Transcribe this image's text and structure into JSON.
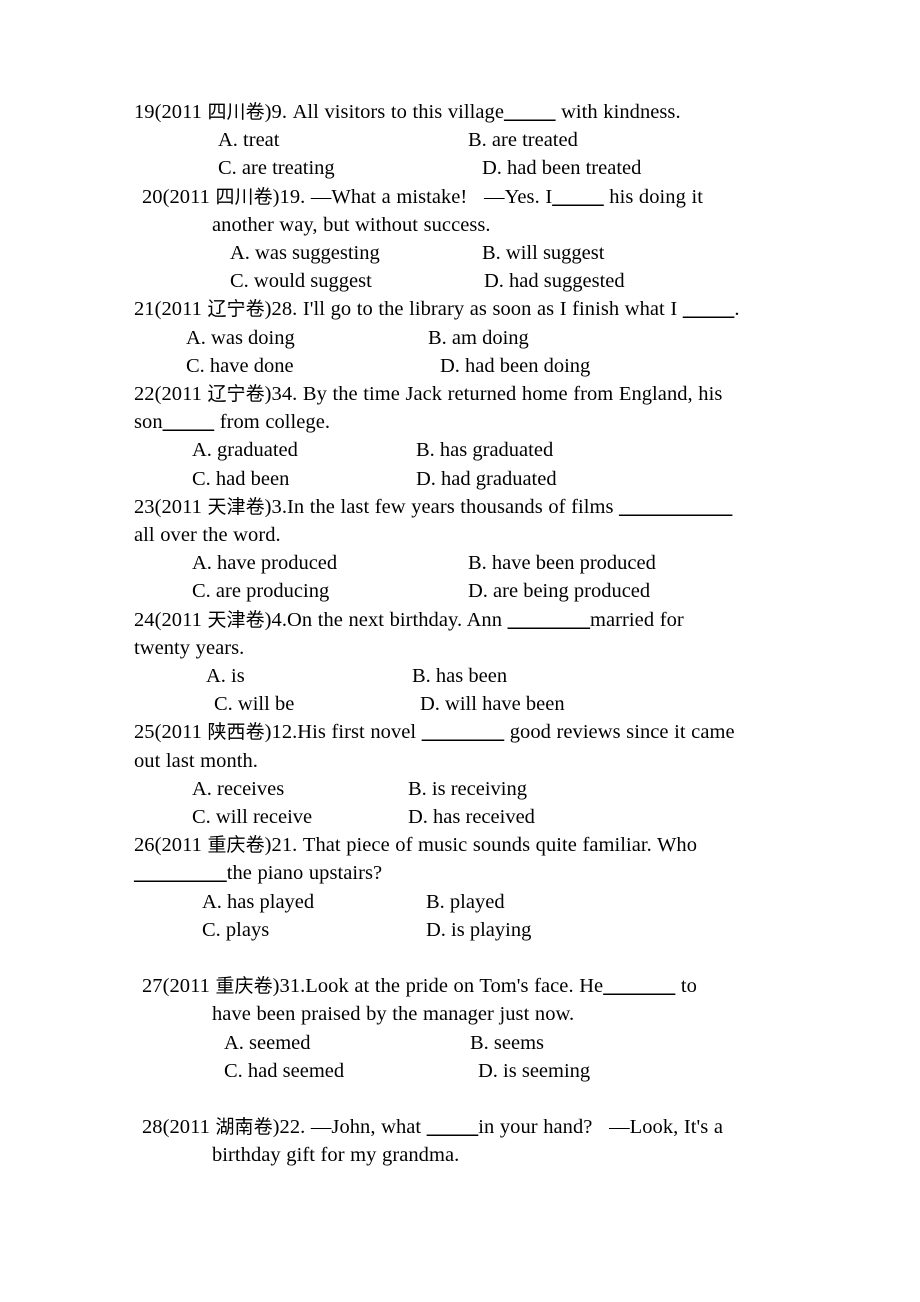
{
  "document": {
    "type": "grammar-exercise-worksheet",
    "language": "en-zh",
    "blank_marker": "_____"
  },
  "questions": [
    {
      "number": "19",
      "source": "(2011 四川卷)",
      "item_number": "9.",
      "stem_lines": [
        {
          "indent": "none",
          "segments": [
            {
              "type": "text",
              "text": "19(2011 "
            },
            {
              "type": "cjk",
              "text": "四川卷"
            },
            {
              "type": "text",
              "text": ")9. All visitors to this village"
            },
            {
              "type": "blank",
              "text": "_____"
            },
            {
              "type": "text",
              "text": " with kindness."
            }
          ]
        }
      ],
      "options": [
        {
          "label": "A.",
          "text": "treat",
          "full": "A. treat",
          "indent": 84,
          "column": "left"
        },
        {
          "label": "B.",
          "text": "are treated",
          "full": "B. are treated",
          "indent": 334,
          "column": "right"
        },
        {
          "label": "C.",
          "text": "are treating",
          "full": "C. are treating",
          "indent": 84,
          "column": "left"
        },
        {
          "label": "D.",
          "text": "had been treated",
          "full": "D. had been treated",
          "indent": 348,
          "column": "right"
        }
      ]
    },
    {
      "number": "20",
      "source": "(2011 四川卷)",
      "item_number": "19.",
      "stem_lines": [
        {
          "indent": "small",
          "segments": [
            {
              "type": "text",
              "text": "20(2011 "
            },
            {
              "type": "cjk",
              "text": "四川卷"
            },
            {
              "type": "text",
              "text": ")19. —What a mistake!   —Yes. I"
            },
            {
              "type": "blank",
              "text": "_____"
            },
            {
              "type": "text",
              "text": " his doing it"
            }
          ]
        },
        {
          "indent": "cont",
          "segments": [
            {
              "type": "text",
              "text": "another way, but without success."
            }
          ]
        }
      ],
      "options": [
        {
          "label": "A.",
          "text": "was suggesting",
          "full": "A. was suggesting",
          "indent": 96,
          "column": "left"
        },
        {
          "label": "B.",
          "text": "will suggest",
          "full": "B. will suggest",
          "indent": 348,
          "column": "right"
        },
        {
          "label": "C.",
          "text": "would suggest",
          "full": "C. would suggest",
          "indent": 96,
          "column": "left"
        },
        {
          "label": "D.",
          "text": "had suggested",
          "full": "D. had suggested",
          "indent": 350,
          "column": "right"
        }
      ]
    },
    {
      "number": "21",
      "source": "(2011 辽宁卷)",
      "item_number": "28.",
      "stem_lines": [
        {
          "indent": "none",
          "segments": [
            {
              "type": "text",
              "text": "21(2011 "
            },
            {
              "type": "cjk",
              "text": "辽宁卷"
            },
            {
              "type": "text",
              "text": ")28. I'll go to the library as soon as I finish what I "
            },
            {
              "type": "blank",
              "text": "_____"
            },
            {
              "type": "text",
              "text": "."
            }
          ]
        }
      ],
      "options": [
        {
          "label": "A.",
          "text": "was doing",
          "full": "A. was doing",
          "indent": 52,
          "column": "left"
        },
        {
          "label": "B.",
          "text": "am doing",
          "full": "B. am doing",
          "indent": 294,
          "column": "right"
        },
        {
          "label": "C.",
          "text": "have done",
          "full": "C. have done",
          "indent": 52,
          "column": "left"
        },
        {
          "label": "D.",
          "text": "had been doing",
          "full": "D. had been doing",
          "indent": 306,
          "column": "right"
        }
      ]
    },
    {
      "number": "22",
      "source": "(2011 辽宁卷)",
      "item_number": "34.",
      "stem_lines": [
        {
          "indent": "none",
          "segments": [
            {
              "type": "text",
              "text": "22(2011 "
            },
            {
              "type": "cjk",
              "text": "辽宁卷"
            },
            {
              "type": "text",
              "text": ")34. By the time Jack returned home from England, his"
            }
          ]
        },
        {
          "indent": "none",
          "segments": [
            {
              "type": "text",
              "text": "son"
            },
            {
              "type": "blank",
              "text": "_____"
            },
            {
              "type": "text",
              "text": " from college."
            }
          ]
        }
      ],
      "options": [
        {
          "label": "A.",
          "text": "graduated",
          "full": "A. graduated",
          "indent": 58,
          "column": "left"
        },
        {
          "label": "B.",
          "text": "has graduated",
          "full": "B. has graduated",
          "indent": 282,
          "column": "right"
        },
        {
          "label": "C.",
          "text": "had been",
          "full": "C. had been",
          "indent": 58,
          "column": "left"
        },
        {
          "label": "D.",
          "text": "had graduated",
          "full": "D. had graduated",
          "indent": 282,
          "column": "right"
        }
      ]
    },
    {
      "number": "23",
      "source": "(2011 天津卷)",
      "item_number": "3.",
      "stem_lines": [
        {
          "indent": "none",
          "segments": [
            {
              "type": "text",
              "text": "23(2011 "
            },
            {
              "type": "cjk",
              "text": "天津卷"
            },
            {
              "type": "text",
              "text": ")3.In the last few years thousands of films "
            },
            {
              "type": "blank",
              "text": "___________"
            }
          ]
        },
        {
          "indent": "none",
          "segments": [
            {
              "type": "text",
              "text": "all over the word."
            }
          ]
        }
      ],
      "options": [
        {
          "label": "A.",
          "text": "have produced",
          "full": "A. have produced",
          "indent": 58,
          "column": "left"
        },
        {
          "label": "B.",
          "text": "have been produced",
          "full": "B. have been produced",
          "indent": 334,
          "column": "right"
        },
        {
          "label": "C.",
          "text": "are producing",
          "full": "C. are producing",
          "indent": 58,
          "column": "left"
        },
        {
          "label": "D.",
          "text": "are being produced",
          "full": "D. are being produced",
          "indent": 334,
          "column": "right"
        }
      ]
    },
    {
      "number": "24",
      "source": "(2011 天津卷)",
      "item_number": "4.",
      "stem_lines": [
        {
          "indent": "none",
          "segments": [
            {
              "type": "text",
              "text": "24(2011 "
            },
            {
              "type": "cjk",
              "text": "天津卷"
            },
            {
              "type": "text",
              "text": ")4.On the next birthday. Ann "
            },
            {
              "type": "blank",
              "text": "________"
            },
            {
              "type": "text",
              "text": "married for"
            }
          ]
        },
        {
          "indent": "none",
          "segments": [
            {
              "type": "text",
              "text": "twenty years."
            }
          ]
        }
      ],
      "options": [
        {
          "label": "A.",
          "text": "is",
          "full": "A. is",
          "indent": 72,
          "column": "left"
        },
        {
          "label": "B.",
          "text": "has been",
          "full": "B. has been",
          "indent": 278,
          "column": "right"
        },
        {
          "label": "C.",
          "text": "will be",
          "full": "C. will be",
          "indent": 80,
          "column": "left"
        },
        {
          "label": "D.",
          "text": "will have been",
          "full": "D. will have been",
          "indent": 286,
          "column": "right"
        }
      ]
    },
    {
      "number": "25",
      "source": "(2011 陕西卷)",
      "item_number": "12.",
      "stem_lines": [
        {
          "indent": "none",
          "segments": [
            {
              "type": "text",
              "text": "25(2011 "
            },
            {
              "type": "cjk",
              "text": "陕西卷"
            },
            {
              "type": "text",
              "text": ")12.His first novel "
            },
            {
              "type": "blank",
              "text": "________"
            },
            {
              "type": "text",
              "text": " good reviews since it came"
            }
          ]
        },
        {
          "indent": "none",
          "segments": [
            {
              "type": "text",
              "text": "out last month."
            }
          ]
        }
      ],
      "options": [
        {
          "label": "A.",
          "text": "receives",
          "full": "A. receives",
          "indent": 58,
          "column": "left"
        },
        {
          "label": "B.",
          "text": "is receiving",
          "full": "B. is receiving",
          "indent": 274,
          "column": "right"
        },
        {
          "label": "C.",
          "text": "will receive",
          "full": "C. will receive",
          "indent": 58,
          "column": "left"
        },
        {
          "label": "D.",
          "text": "has received",
          "full": "D. has received",
          "indent": 274,
          "column": "right"
        }
      ]
    },
    {
      "number": "26",
      "source": "(2011 重庆卷)",
      "item_number": "21.",
      "stem_lines": [
        {
          "indent": "none",
          "segments": [
            {
              "type": "text",
              "text": "26(2011 "
            },
            {
              "type": "cjk",
              "text": "重庆卷"
            },
            {
              "type": "text",
              "text": ")21. That piece of music sounds quite familiar. Who"
            }
          ]
        },
        {
          "indent": "none",
          "segments": [
            {
              "type": "blank",
              "text": "_________"
            },
            {
              "type": "text",
              "text": "the piano upstairs?"
            }
          ]
        }
      ],
      "options": [
        {
          "label": "A.",
          "text": "has played",
          "full": "A. has played",
          "indent": 68,
          "column": "left"
        },
        {
          "label": "B.",
          "text": "played",
          "full": "B. played",
          "indent": 292,
          "column": "right"
        },
        {
          "label": "C.",
          "text": "plays",
          "full": "C. plays",
          "indent": 68,
          "column": "left"
        },
        {
          "label": "D.",
          "text": "is playing",
          "full": "D. is playing",
          "indent": 292,
          "column": "right"
        }
      ]
    },
    {
      "number": "27",
      "source": "(2011 重庆卷)",
      "item_number": "31.",
      "leading_blank_line": true,
      "stem_lines": [
        {
          "indent": "small",
          "segments": [
            {
              "type": "text",
              "text": "27(2011 "
            },
            {
              "type": "cjk",
              "text": "重庆卷"
            },
            {
              "type": "text",
              "text": ")31.Look at the pride on Tom's face. He"
            },
            {
              "type": "blank",
              "text": "_______"
            },
            {
              "type": "text",
              "text": " to"
            }
          ]
        },
        {
          "indent": "cont",
          "segments": [
            {
              "type": "text",
              "text": "have been praised by the manager just now."
            }
          ]
        }
      ],
      "options": [
        {
          "label": "A.",
          "text": "seemed",
          "full": "A. seemed",
          "indent": 90,
          "column": "left"
        },
        {
          "label": "B.",
          "text": "seems",
          "full": "B. seems",
          "indent": 336,
          "column": "right"
        },
        {
          "label": "C.",
          "text": "had seemed",
          "full": "C. had seemed",
          "indent": 90,
          "column": "left"
        },
        {
          "label": "D.",
          "text": "is seeming",
          "full": "D. is seeming",
          "indent": 344,
          "column": "right"
        }
      ]
    },
    {
      "number": "28",
      "source": "(2011 湖南卷)",
      "item_number": "22.",
      "leading_blank_line": true,
      "stem_lines": [
        {
          "indent": "small",
          "segments": [
            {
              "type": "text",
              "text": "28(2011 "
            },
            {
              "type": "cjk",
              "text": "湖南卷"
            },
            {
              "type": "text",
              "text": ")22. —John, what "
            },
            {
              "type": "blank",
              "text": "_____"
            },
            {
              "type": "text",
              "text": "in your hand?   —Look, It's a"
            }
          ]
        },
        {
          "indent": "cont",
          "segments": [
            {
              "type": "text",
              "text": "birthday gift for my grandma."
            }
          ]
        }
      ],
      "options": []
    }
  ]
}
